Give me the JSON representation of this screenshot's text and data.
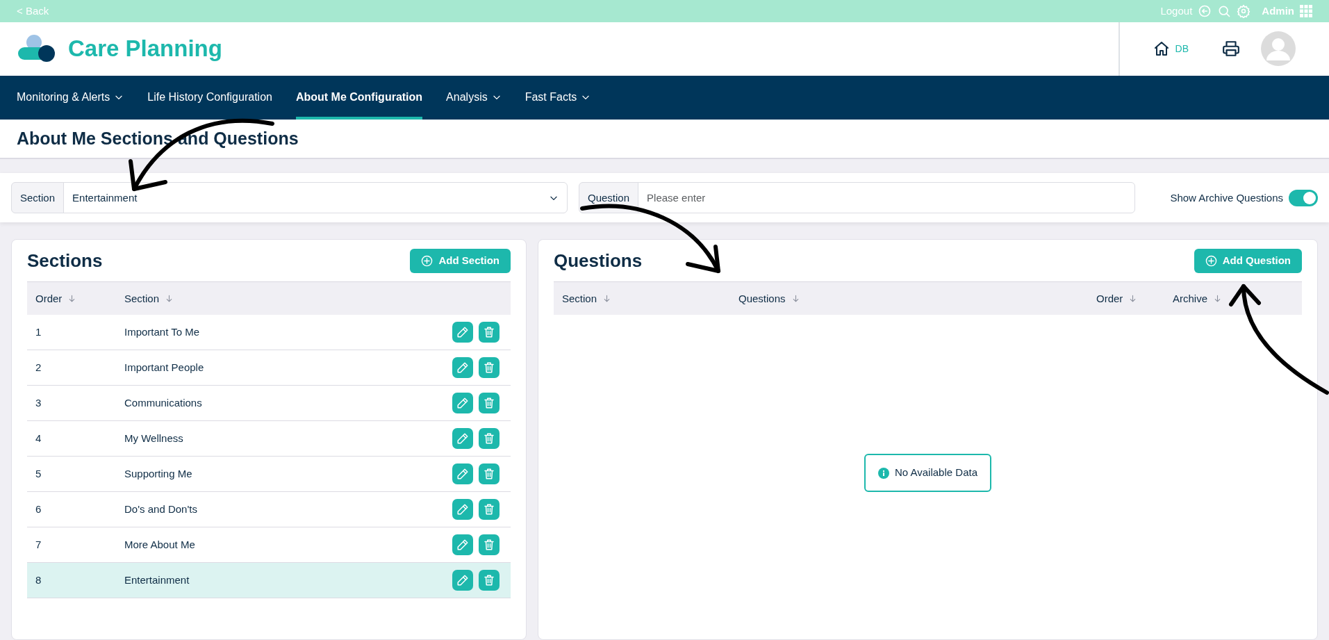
{
  "top_bar": {
    "back": "< Back",
    "logout": "Logout",
    "user": "Admin"
  },
  "header": {
    "app_title": "Care Planning",
    "home_label": "DB"
  },
  "nav": [
    {
      "label": "Monitoring & Alerts",
      "dropdown": true,
      "selected": false
    },
    {
      "label": "Life History Configuration",
      "dropdown": false,
      "selected": false
    },
    {
      "label": "About Me Configuration",
      "dropdown": false,
      "selected": true
    },
    {
      "label": "Analysis",
      "dropdown": true,
      "selected": false
    },
    {
      "label": "Fast Facts",
      "dropdown": true,
      "selected": false
    }
  ],
  "page_title": "About Me Sections and Questions",
  "filters": {
    "section": {
      "label": "Section",
      "value": "Entertainment"
    },
    "question": {
      "label": "Question",
      "placeholder": "Please enter"
    },
    "archive_toggle": {
      "label": "Show Archive Questions",
      "on": true
    }
  },
  "sections_panel": {
    "title": "Sections",
    "add_button": "Add Section",
    "columns": [
      "Order",
      "Section"
    ],
    "rows": [
      {
        "order": "1",
        "section": "Important To Me",
        "selected": false
      },
      {
        "order": "2",
        "section": "Important People",
        "selected": false
      },
      {
        "order": "3",
        "section": "Communications",
        "selected": false
      },
      {
        "order": "4",
        "section": "My Wellness",
        "selected": false
      },
      {
        "order": "5",
        "section": "Supporting Me",
        "selected": false
      },
      {
        "order": "6",
        "section": "Do's and Don'ts",
        "selected": false
      },
      {
        "order": "7",
        "section": "More About Me",
        "selected": false
      },
      {
        "order": "8",
        "section": "Entertainment",
        "selected": true
      }
    ]
  },
  "questions_panel": {
    "title": "Questions",
    "add_button": "Add Question",
    "columns": [
      "Section",
      "Questions",
      "Order",
      "Archive"
    ],
    "empty_message": "No Available Data"
  }
}
